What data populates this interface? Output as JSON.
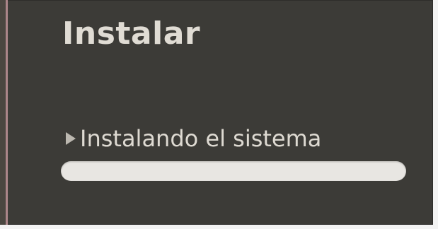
{
  "window": {
    "title": "Instalar"
  },
  "progress": {
    "status_text": "Instalando el sistema",
    "expander_icon": "triangle-right-icon",
    "fraction": 0.0
  },
  "colors": {
    "background": "#3c3b37",
    "text": "#dedad2",
    "progress_track": "#e8e6e2",
    "progress_fill": "#dd4814"
  }
}
